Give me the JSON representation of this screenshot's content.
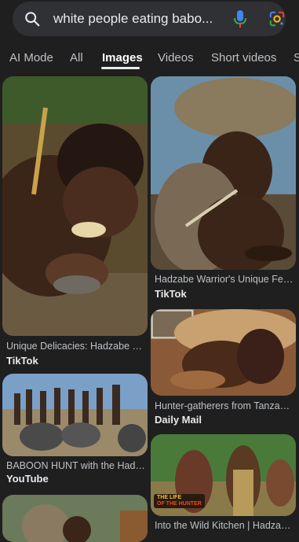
{
  "search": {
    "query": "white people eating babo..."
  },
  "tabs": [
    {
      "label": "AI Mode"
    },
    {
      "label": "All"
    },
    {
      "label": "Images"
    },
    {
      "label": "Videos"
    },
    {
      "label": "Short videos"
    },
    {
      "label": "S"
    }
  ],
  "results": [
    {
      "title": "Unique Delicacies: Hadzabe Bu...",
      "source": "TikTok"
    },
    {
      "title": "Hadzabe Warrior's Unique Feas...",
      "source": "TikTok"
    },
    {
      "title": "Hunter-gatherers from Tanzani...",
      "source": "Daily Mail"
    },
    {
      "title": "BABOON HUNT with the Hadza...",
      "source": "YouTube"
    },
    {
      "title": "Into the Wild Kitchen | Hadzabe...",
      "source": ""
    },
    {
      "title": "",
      "source": ""
    }
  ],
  "overlay_text": {
    "life_badge_line1": "THE LIFE",
    "life_badge_line2": "OF THE HUNTER"
  },
  "colors": {
    "background": "#1f1f1f",
    "searchbar": "#303134",
    "mic_blue": "#4285f4",
    "tab_active": "#ffffff"
  }
}
